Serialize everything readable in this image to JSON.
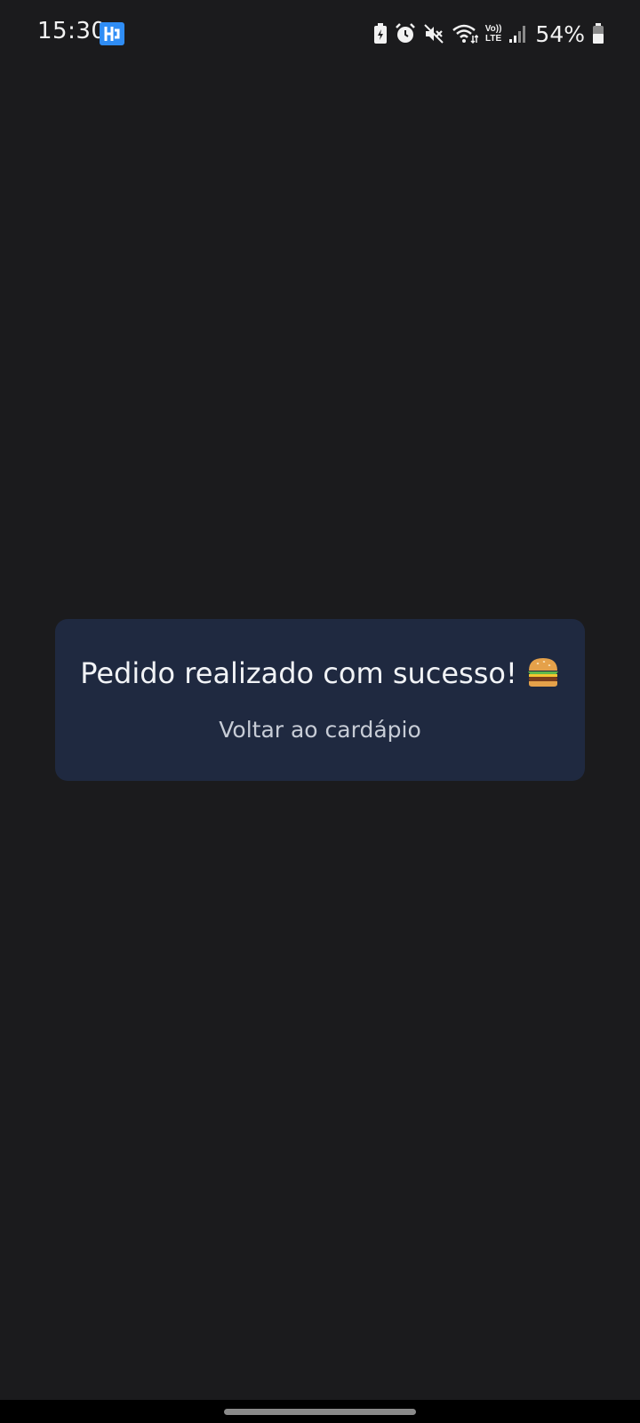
{
  "status_bar": {
    "time": "15:30",
    "app_icon": "h-app-icon",
    "icons": [
      "battery-saver-icon",
      "alarm-icon",
      "mute-icon",
      "wifi-icon",
      "volte-icon",
      "signal-icon",
      "battery-icon"
    ],
    "volte_top": "Vo))",
    "volte_bottom": "LTE",
    "battery_percent": "54%"
  },
  "dialog": {
    "title": "Pedido realizado com sucesso!",
    "title_icon": "burger-emoji-icon",
    "back_link": "Voltar ao cardápio"
  },
  "colors": {
    "background": "#1b1b1d",
    "card": "#1f2940",
    "title_text": "#f1f3f6",
    "link_text": "#c7ccd6",
    "app_badge": "#2f8df5"
  }
}
